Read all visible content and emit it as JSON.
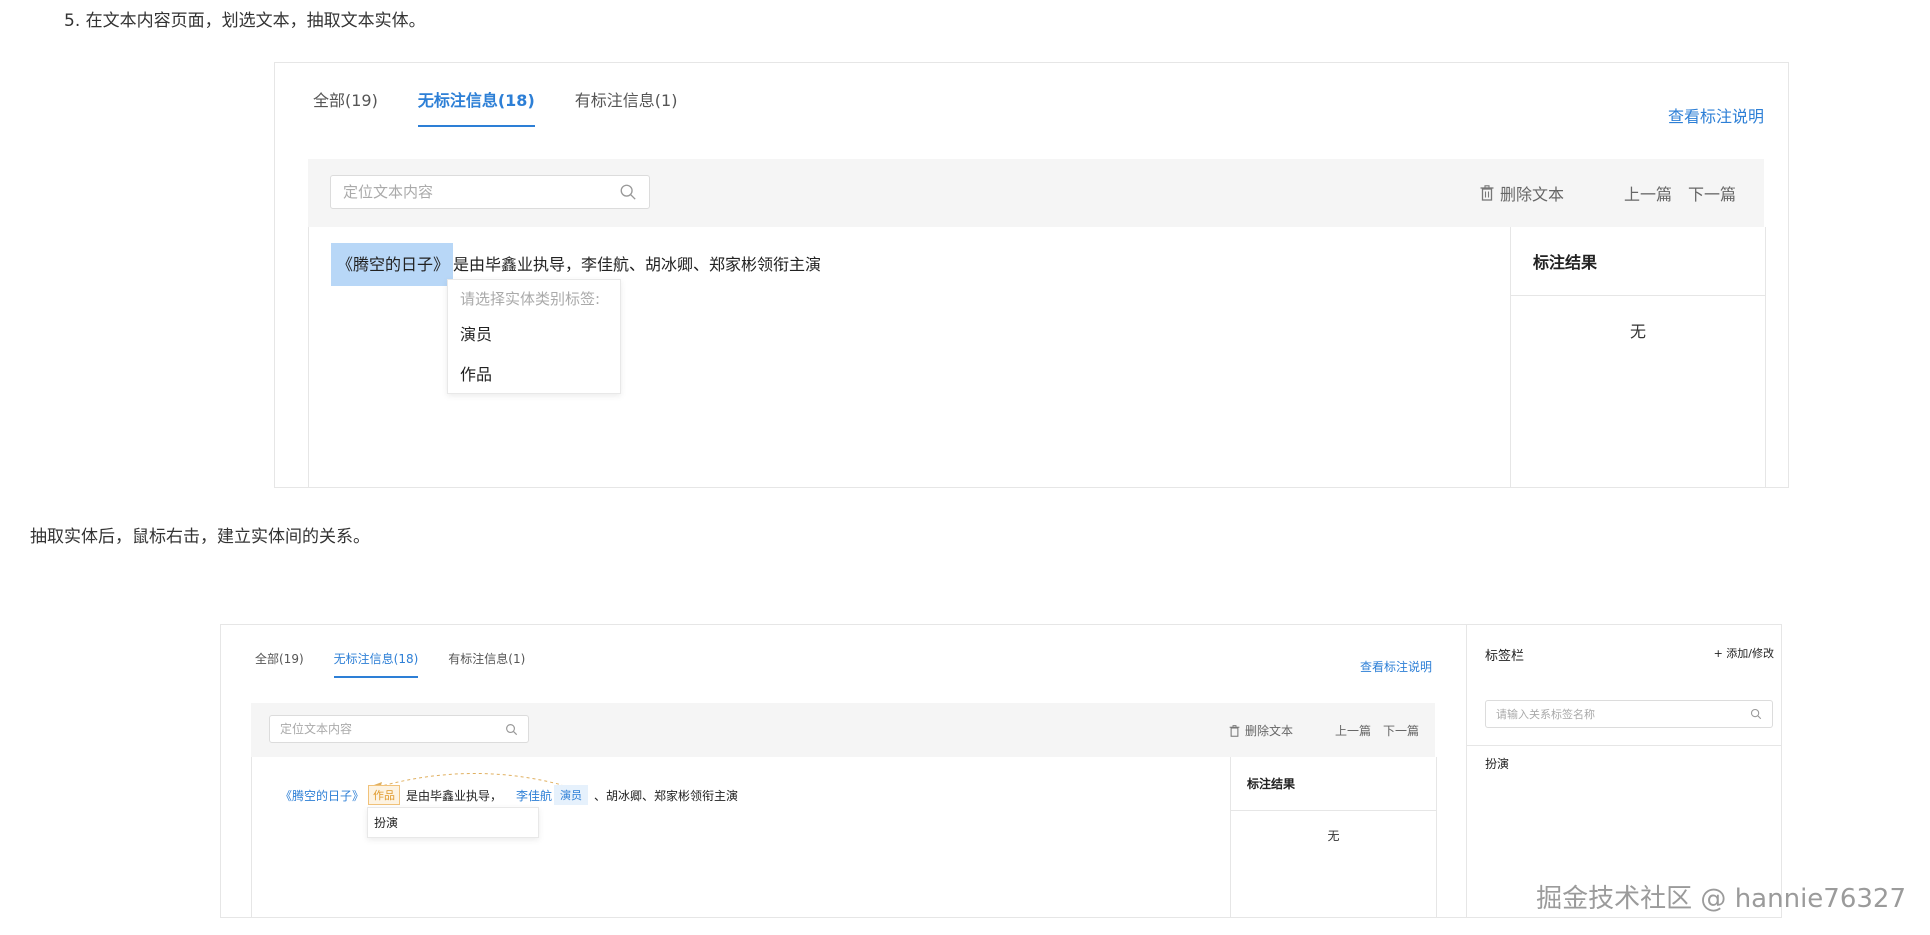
{
  "article": {
    "step_text": "5. 在文本内容页面，划选文本，抽取文本实体。",
    "para_text": "抽取实体后，鼠标右击，建立实体间的关系。",
    "watermark": "掘金技术社区 @ hannie76327"
  },
  "shot1": {
    "tabs": [
      {
        "label": "全部(19)"
      },
      {
        "label": "无标注信息(18)",
        "active": true
      },
      {
        "label": "有标注信息(1)"
      }
    ],
    "help_link": "查看标注说明",
    "search_placeholder": "定位文本内容",
    "delete_label": "删除文本",
    "prev_label": "上一篇",
    "next_label": "下一篇",
    "selected_text": "《腾空的日子》",
    "sentence_rest": "是由毕鑫业执导，李佳航、胡冰卿、郑家彬领衔主演",
    "dropdown": {
      "title": "请选择实体类别标签:",
      "items": [
        "演员",
        "作品"
      ]
    },
    "result_title": "标注结果",
    "result_empty": "无"
  },
  "shot2": {
    "tabs": [
      {
        "label": "全部(19)"
      },
      {
        "label": "无标注信息(18)",
        "active": true
      },
      {
        "label": "有标注信息(1)"
      }
    ],
    "help_link": "查看标注说明",
    "search_placeholder": "定位文本内容",
    "delete_label": "删除文本",
    "prev_label": "上一篇",
    "next_label": "下一篇",
    "entity1": "《腾空的日子》",
    "entity1_tag": "作品",
    "text_mid": "是由毕鑫业执导，",
    "entity2": "李佳航",
    "entity2_tag": "演员",
    "text_end": "、胡冰卿、郑家彬领衔主演",
    "relation_dropdown": [
      "扮演"
    ],
    "result_title": "标注结果",
    "result_empty": "无",
    "side": {
      "title": "标签栏",
      "add_label": "+ 添加/修改",
      "search_placeholder": "请输入关系标签名称",
      "items": [
        "扮演"
      ]
    }
  },
  "colors": {
    "accent": "#2d7fd6",
    "selection": "#b8d7f7",
    "tag_orange": "#e09a2c",
    "toolbar_bg": "#f5f5f5"
  }
}
